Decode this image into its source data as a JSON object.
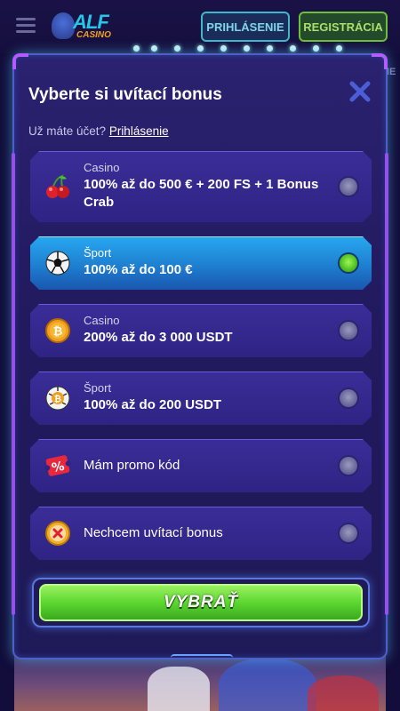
{
  "header": {
    "login_label": "PRIHLÁSENIE",
    "register_label": "REGISTRÁCIA",
    "logo_text": "ALF",
    "logo_sub": "CASINO",
    "peek_text": "NE"
  },
  "modal": {
    "title": "Vyberte si uvítací bonus",
    "subtitle_prefix": "Už máte účet?",
    "subtitle_link": "Prihlásenie",
    "options": [
      {
        "category": "Casino",
        "value": "100% až do 500 € + 200 FS + 1 Bonus Crab",
        "icon": "cherries-icon",
        "selected": false
      },
      {
        "category": "Šport",
        "value": "100% až do 100 €",
        "icon": "soccer-ball-icon",
        "selected": true
      },
      {
        "category": "Casino",
        "value": "200% až do 3 000 USDT",
        "icon": "bitcoin-coin-icon",
        "selected": false
      },
      {
        "category": "Šport",
        "value": "100% až do 200 USDT",
        "icon": "bitcoin-soccer-ball-icon",
        "selected": false
      },
      {
        "category": "",
        "value": "Mám promo kód",
        "icon": "promo-percent-icon",
        "selected": false
      },
      {
        "category": "",
        "value": "Nechcem uvítací bonus",
        "icon": "no-bonus-x-icon",
        "selected": false
      }
    ],
    "cta_label": "VYBRAŤ"
  },
  "colors": {
    "modal_bg": "#211a5e",
    "selected_option": "#1e7fd0",
    "cta_green": "#5cd830",
    "accent_purple": "#b05cff"
  }
}
